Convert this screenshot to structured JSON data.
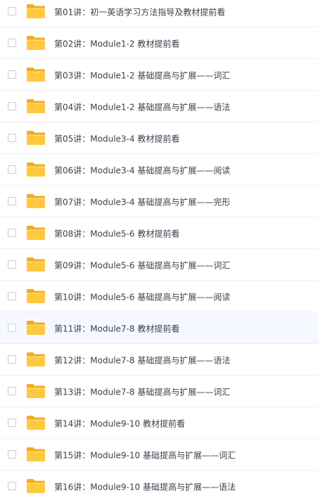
{
  "files": [
    {
      "name": "第01讲：初一英语学习方法指导及教材提前看",
      "icon": "folder-icon"
    },
    {
      "name": "第02讲：Module1-2 教材提前看",
      "icon": "folder-icon"
    },
    {
      "name": "第03讲：Module1-2 基础提高与扩展——词汇",
      "icon": "folder-icon"
    },
    {
      "name": "第04讲：Module1-2 基础提高与扩展——语法",
      "icon": "folder-icon"
    },
    {
      "name": "第05讲：Module3-4 教材提前看",
      "icon": "folder-icon"
    },
    {
      "name": "第06讲：Module3-4 基础提高与扩展——阅读",
      "icon": "folder-icon"
    },
    {
      "name": "第07讲：Module3-4 基础提高与扩展——完形",
      "icon": "folder-icon"
    },
    {
      "name": "第08讲：Module5-6 教材提前看",
      "icon": "folder-icon"
    },
    {
      "name": "第09讲：Module5-6 基础提高与扩展——词汇",
      "icon": "folder-icon"
    },
    {
      "name": "第10讲：Module5-6 基础提高与扩展——阅读",
      "icon": "folder-icon"
    },
    {
      "name": "第11讲：Module7-8 教材提前看",
      "icon": "folder-icon"
    },
    {
      "name": "第12讲：Module7-8 基础提高与扩展——语法",
      "icon": "folder-icon"
    },
    {
      "name": "第13讲：Module7-8 基础提高与扩展——词汇",
      "icon": "folder-icon"
    },
    {
      "name": "第14讲：Module9-10 教材提前看",
      "icon": "folder-icon"
    },
    {
      "name": "第15讲：Module9-10 基础提高与扩展——词汇",
      "icon": "folder-icon"
    },
    {
      "name": "第16讲：Module9-10 基础提高与扩展——语法",
      "icon": "folder-icon"
    }
  ],
  "colors": {
    "folder_body": "#ffc83d",
    "folder_back": "#f0ad1e",
    "text": "#3a3f4b",
    "hover_row": "#f5f9ff",
    "divider": "#eef0f4"
  }
}
